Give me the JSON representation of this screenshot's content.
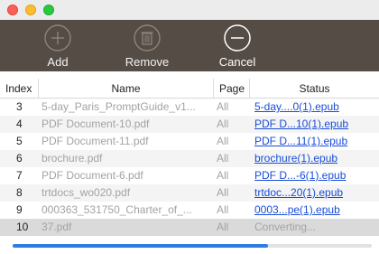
{
  "window": {
    "controls": [
      "close",
      "minimize",
      "zoom"
    ]
  },
  "toolbar": {
    "buttons": [
      {
        "label": "Add",
        "icon": "plus-circle-icon",
        "enabled": false
      },
      {
        "label": "Remove",
        "icon": "trash-icon",
        "enabled": false
      },
      {
        "label": "Cancel",
        "icon": "minus-circle-icon",
        "enabled": true
      }
    ]
  },
  "table": {
    "columns": [
      "Index",
      "Name",
      "Page",
      "Status"
    ],
    "rows": [
      {
        "index": "3",
        "name": "5-day_Paris_PromptGuide_v1...",
        "page": "All",
        "status": "5-day....0(1).epub"
      },
      {
        "index": "4",
        "name": "PDF Document-10.pdf",
        "page": "All",
        "status": "PDF D...10(1).epub"
      },
      {
        "index": "5",
        "name": "PDF Document-11.pdf",
        "page": "All",
        "status": "PDF D...11(1).epub"
      },
      {
        "index": "6",
        "name": "brochure.pdf",
        "page": "All",
        "status": "brochure(1).epub"
      },
      {
        "index": "7",
        "name": "PDF Document-6.pdf",
        "page": "All",
        "status": "PDF D...-6(1).epub"
      },
      {
        "index": "8",
        "name": "trtdocs_wo020.pdf",
        "page": "All",
        "status": "trtdoc...20(1).epub"
      },
      {
        "index": "9",
        "name": "000363_531750_Charter_of_...",
        "page": "All",
        "status": "0003...pe(1).epub"
      },
      {
        "index": "10",
        "name": "37.pdf",
        "page": "All",
        "status": "Converting..."
      }
    ]
  },
  "progress": {
    "fraction": 0.71,
    "color": "#2f7de0"
  },
  "colors": {
    "toolbar_bg": "#554d45",
    "link": "#1a4ed8",
    "muted_text": "#a3a3a3"
  }
}
